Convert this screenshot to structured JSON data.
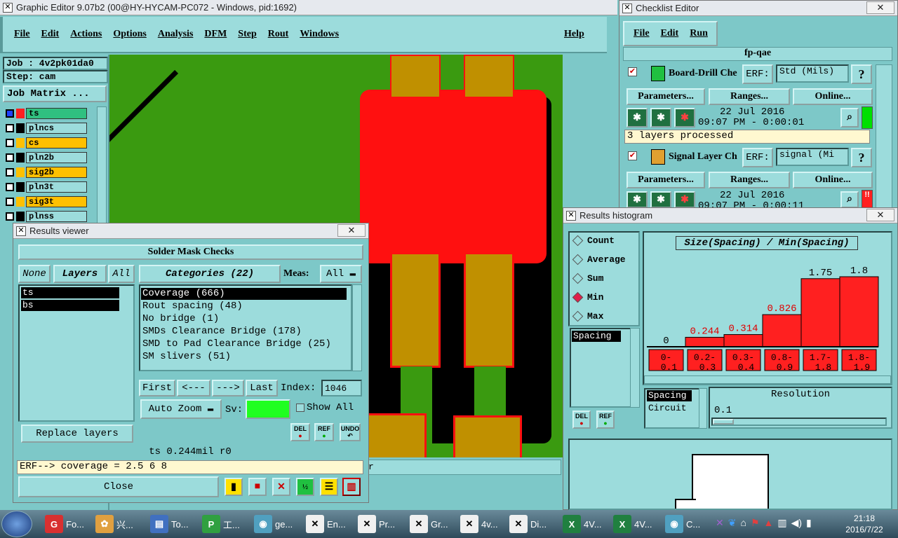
{
  "main": {
    "title": "Graphic Editor 9.07b2 (00@HY-HYCAM-PC072 - Windows, pid:1692)",
    "menu": [
      "File",
      "Edit",
      "Actions",
      "Options",
      "Analysis",
      "DFM",
      "Step",
      "Rout",
      "Windows"
    ],
    "help": "Help",
    "job": "Job : 4v2pk01da0",
    "step": "Step: cam",
    "job_matrix": "Job Matrix ...",
    "layers": [
      {
        "name": "ts",
        "color": "#ff2020"
      },
      {
        "name": "plncs",
        "color": "#000000"
      },
      {
        "name": "cs",
        "color": "#ffc000"
      },
      {
        "name": "pln2b",
        "color": "#000000"
      },
      {
        "name": "sig2b",
        "color": "#ffc000"
      },
      {
        "name": "pln3t",
        "color": "#000000"
      },
      {
        "name": "sig3t",
        "color": "#ffc000"
      },
      {
        "name": "plnss",
        "color": "#000000"
      }
    ],
    "status_fragment": "r"
  },
  "checklist": {
    "title": "Checklist Editor",
    "menu": [
      "File",
      "Edit",
      "Run"
    ],
    "name": "fp-qae",
    "items": [
      {
        "label": "Board-Drill Che",
        "erf_label": "ERF:",
        "erf_value": "Std (Mils)",
        "params": "Parameters...",
        "ranges": "Ranges...",
        "online": "Online...",
        "date": "22 Jul 2016",
        "time": "09:07 PM - 0:00:01",
        "status": "3 layers processed",
        "status_color": "#00e000"
      },
      {
        "label": "Signal Layer Ch",
        "erf_label": "ERF:",
        "erf_value": "signal (Mi",
        "params": "Parameters...",
        "ranges": "Ranges...",
        "online": "Online...",
        "date": "22 Jul 2016",
        "time": "09:07 PM - 0:00:11",
        "status_color": "#ff2020",
        "status_mark": "!!"
      }
    ]
  },
  "results": {
    "title": "Results viewer",
    "header": "Solder Mask Checks",
    "none": "None",
    "layers_label": "Layers",
    "all": "All",
    "layer_list": [
      "ts",
      "bs"
    ],
    "categories_label": "Categories (22)",
    "meas_label": "Meas:",
    "meas_value": "All",
    "categories": [
      "Coverage (666)",
      "Rout spacing (48)",
      "No bridge (1)",
      "SMDs Clearance Bridge (178)",
      "SMD to Pad Clearance Bridge (25)",
      "SM slivers (51)"
    ],
    "first": "First",
    "prev": "<---",
    "next": "--->",
    "last": "Last",
    "index_label": "Index:",
    "index_value": "1046",
    "auto_zoom": "Auto Zoom",
    "sv_label": "Sv:",
    "show_all": "Show All",
    "replace_layers": "Replace layers",
    "del": "DEL",
    "ref": "REF",
    "undo": "UNDO",
    "status": "ts 0.244mil  r0",
    "erf_line": "ERF--> coverage = 2.5 6 8",
    "close": "Close"
  },
  "histogram": {
    "title": "Results histogram",
    "modes": [
      "Count",
      "Average",
      "Sum",
      "Min",
      "Max"
    ],
    "selected_mode": "Min",
    "chart_title": "Size(Spacing) / Min(Spacing)",
    "list_item": "Spacing",
    "del": "DEL",
    "ref": "REF",
    "subjects": [
      "Spacing",
      "Circuit"
    ],
    "resolution_label": "Resolution",
    "resolution_value": "0.1"
  },
  "chart_data": {
    "type": "bar",
    "title": "Size(Spacing) / Min(Spacing)",
    "categories": [
      "0-0.1",
      "0.2-0.3",
      "0.3-0.4",
      "0.8-0.9",
      "1.7-1.8",
      "1.8-1.9"
    ],
    "values": [
      0,
      0.244,
      0.314,
      0.826,
      1.75,
      1.8
    ],
    "value_labels": [
      "0",
      "0.244",
      "0.314",
      "0.826",
      "1.75",
      "1.8"
    ],
    "cat_top": [
      "0-",
      "0.2-",
      "0.3-",
      "0.8-",
      "1.7-",
      "1.8-"
    ],
    "cat_bottom": [
      "0.1",
      "0.3",
      "0.4",
      "0.9",
      "1.8",
      "1.9"
    ],
    "bar_color": "#ff2020",
    "ylim": [
      0,
      1.8
    ]
  },
  "taskbar": {
    "items": [
      {
        "label": "Fo...",
        "color": "#d83030",
        "icon": "G"
      },
      {
        "label": "兴...",
        "color": "#e0a040",
        "icon": "✿"
      },
      {
        "label": "To...",
        "color": "#4070c0",
        "icon": "▤"
      },
      {
        "label": "工...",
        "color": "#30a040",
        "icon": "P"
      },
      {
        "label": "ge...",
        "color": "#50a0c0",
        "icon": "◉"
      },
      {
        "label": "En...",
        "color": "#f0f0f0",
        "icon": "✕"
      },
      {
        "label": "Pr...",
        "color": "#f0f0f0",
        "icon": "✕"
      },
      {
        "label": "Gr...",
        "color": "#f0f0f0",
        "icon": "✕"
      },
      {
        "label": "4v...",
        "color": "#f0f0f0",
        "icon": "✕"
      },
      {
        "label": "Di...",
        "color": "#f0f0f0",
        "icon": "✕"
      },
      {
        "label": "4V...",
        "color": "#208040",
        "icon": "X"
      },
      {
        "label": "4V...",
        "color": "#208040",
        "icon": "X"
      },
      {
        "label": "C...",
        "color": "#50a0c0",
        "icon": "◉"
      }
    ],
    "clock_time": "21:18",
    "clock_date": "2016/7/22"
  }
}
